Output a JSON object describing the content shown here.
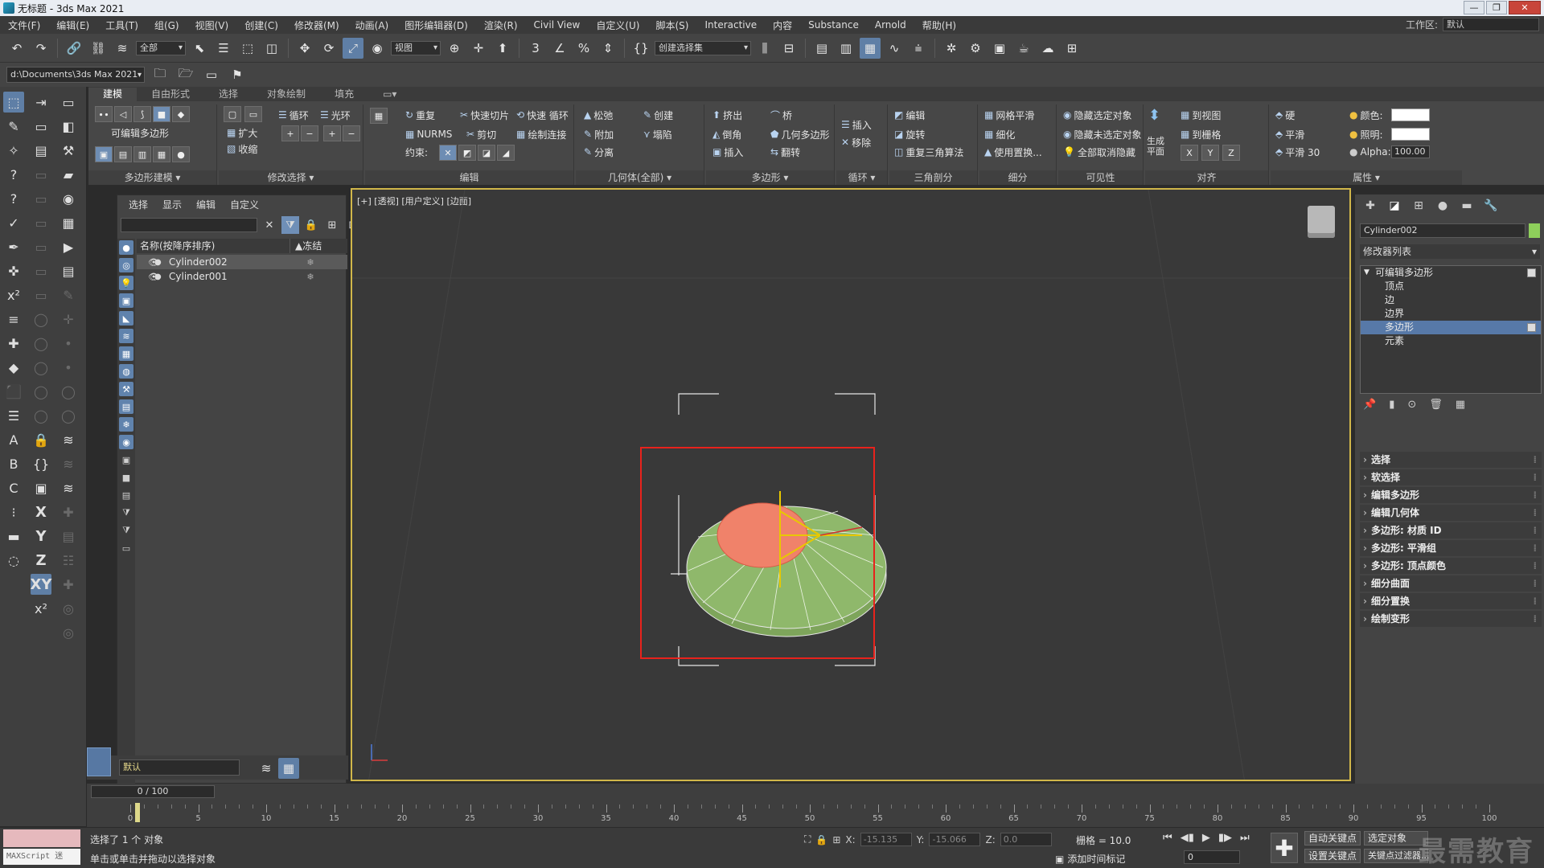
{
  "window": {
    "title": "无标题 - 3ds Max 2021",
    "controls": [
      "—",
      "❐",
      "✕"
    ]
  },
  "menubar": {
    "items": [
      "文件(F)",
      "编辑(E)",
      "工具(T)",
      "组(G)",
      "视图(V)",
      "创建(C)",
      "修改器(M)",
      "动画(A)",
      "图形编辑器(D)",
      "渲染(R)",
      "Civil View",
      "自定义(U)",
      "脚本(S)",
      "Interactive",
      "内容",
      "Substance",
      "Arnold",
      "帮助(H)"
    ],
    "workspace_label": "工作区:",
    "workspace_value": "默认"
  },
  "toolbar": {
    "filter_value": "全部",
    "refcoord_value": "视图",
    "named_selection_value": "创建选择集"
  },
  "toolbar2": {
    "path_value": "d:\\Documents\\3ds Max 2021"
  },
  "ribbon": {
    "tabs": [
      "建模",
      "自由形式",
      "选择",
      "对象绘制",
      "填充"
    ],
    "groups": {
      "poly_modeling": {
        "label": "多边形建模 ▾",
        "editable_poly": "可编辑多边形"
      },
      "modify_selection": {
        "label": "修改选择 ▾",
        "grow": "扩大",
        "shrink": "收缩",
        "loop": "循环",
        "ring": "光环"
      },
      "edit": {
        "label": "编辑",
        "repeat": "重复",
        "quickslice": "快速切片",
        "quickloop": "快速 循环",
        "nurms": "NURMS",
        "cut": "剪切",
        "paintconnect": "绘制连接",
        "constraint": "约束:"
      },
      "geometry": {
        "label": "几何体(全部) ▾",
        "relax": "松弛",
        "create": "创建",
        "attach": "附加",
        "collapse": "塌陷",
        "detach": "分离"
      },
      "polygons": {
        "label": "多边形 ▾",
        "extrude": "挤出",
        "bridge": "桥",
        "bevel": "倒角",
        "geopoly": "几何多边形",
        "inset": "插入",
        "flip": "翻转"
      },
      "loops": {
        "label": "循环 ▾",
        "insert": "插入",
        "remove": "移除"
      },
      "tris": {
        "label": "三角剖分",
        "edit": "编辑",
        "turn": "旋转",
        "retri": "重复三角算法"
      },
      "subdivision": {
        "label": "细分",
        "meshsmooth": "网格平滑",
        "tessellate": "细化",
        "usedisp": "使用置换..."
      },
      "visibility": {
        "label": "可见性",
        "hidesel": "隐藏选定对象",
        "hideunsel": "隐藏未选定对象",
        "unhideall": "全部取消隐藏"
      },
      "align": {
        "label": "对齐",
        "makeplanar": "生成\n平面",
        "toview": "到视图",
        "togrid": "到栅格",
        "x": "X",
        "y": "Y",
        "z": "Z"
      },
      "properties": {
        "label": "属性 ▾",
        "hard": "硬",
        "smooth": "平滑",
        "smooth30": "平滑 30",
        "color": "颜色:",
        "illum": "照明:",
        "alpha": "Alpha:",
        "alpha_value": "100.00"
      }
    }
  },
  "scene_explorer": {
    "menu": [
      "选择",
      "显示",
      "编辑",
      "自定义"
    ],
    "header_name": "名称(按降序排序)",
    "header_freeze": "▲冻结",
    "rows": [
      {
        "name": "Cylinder002",
        "selected": true
      },
      {
        "name": "Cylinder001",
        "selected": false
      }
    ],
    "layer_value": "默认"
  },
  "viewport": {
    "label": "[+] [透视] [用户定义] [边面]"
  },
  "command_panel": {
    "object_name": "Cylinder002",
    "modifier_list": "修改器列表",
    "stack": [
      {
        "label": "可编辑多边形",
        "level": "root",
        "active": false
      },
      {
        "label": "顶点",
        "level": "sub",
        "active": false
      },
      {
        "label": "边",
        "level": "sub",
        "active": false
      },
      {
        "label": "边界",
        "level": "sub",
        "active": false
      },
      {
        "label": "多边形",
        "level": "sub",
        "active": true
      },
      {
        "label": "元素",
        "level": "sub",
        "active": false
      }
    ],
    "rollouts": [
      "选择",
      "软选择",
      "编辑多边形",
      "编辑几何体",
      "多边形: 材质 ID",
      "多边形: 平滑组",
      "多边形: 顶点颜色",
      "细分曲面",
      "细分置换",
      "绘制变形"
    ]
  },
  "timeline": {
    "frame_readout": "0 / 100",
    "ticks": [
      0,
      5,
      10,
      15,
      20,
      25,
      30,
      35,
      40,
      45,
      50,
      55,
      60,
      65,
      70,
      75,
      80,
      85,
      90,
      95,
      100
    ]
  },
  "statusbar": {
    "maxscript_label": "MAXScript 迷",
    "status_line1": "选择了 1 个 对象",
    "status_line2": "单击或单击并拖动以选择对象",
    "x_label": "X:",
    "x_value": "-15.135",
    "y_label": "Y:",
    "y_value": "-15.066",
    "z_label": "Z:",
    "z_value": "0.0",
    "grid": "栅格 = 10.0",
    "add_time_tag": "添加时间标记",
    "frame_value": "0",
    "autokey": "自动关键点",
    "setkey": "设置关键点",
    "selected_object": "选定对象",
    "key_filters": "关键点过滤器...",
    "watermark": "最需教育"
  },
  "colors": {
    "accent": "#5f7fa6",
    "viewport_border": "#d1b74a",
    "highlight": "#e8221c",
    "mesh_green": "#8fb86b",
    "poly_face": "#f0826a"
  }
}
